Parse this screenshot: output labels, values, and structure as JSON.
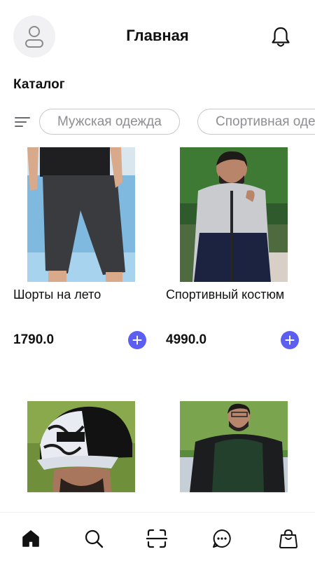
{
  "header": {
    "title": "Главная",
    "avatar_icon": "user-icon",
    "bell_icon": "bell-icon"
  },
  "catalog": {
    "title": "Каталог",
    "filter_icon": "filter-lines-icon",
    "chips": [
      {
        "label": "Мужская одежда"
      },
      {
        "label": "Спортивная одежда"
      }
    ]
  },
  "products": [
    {
      "name": "Шорты на лето",
      "price": "1790.0"
    },
    {
      "name": "Спортивный костюм",
      "price": "4990.0"
    },
    {
      "name": "",
      "price": ""
    },
    {
      "name": "",
      "price": ""
    }
  ],
  "tabbar": {
    "items": [
      {
        "icon": "home-icon",
        "active": true
      },
      {
        "icon": "search-icon",
        "active": false
      },
      {
        "icon": "scan-icon",
        "active": false
      },
      {
        "icon": "chat-icon",
        "active": false
      },
      {
        "icon": "bag-icon",
        "active": false
      }
    ]
  },
  "colors": {
    "accent": "#5b5ef0",
    "chip_border": "#c8c8cc",
    "chip_text": "#8e8e93"
  }
}
